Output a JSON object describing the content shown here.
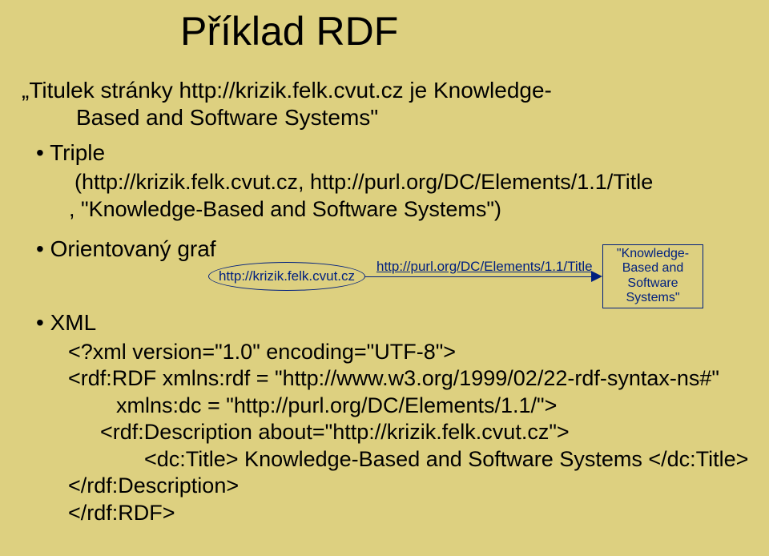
{
  "title": "Příklad RDF",
  "statement": {
    "line1": "„Titulek stránky http://krizik.felk.cvut.cz je Knowledge-",
    "line2": "Based and Software Systems\""
  },
  "bullets": {
    "triple": "Triple",
    "triple_sub1": "(http://krizik.felk.cvut.cz, http://purl.org/DC/Elements/1.1/Title",
    "triple_sub2": ", \"Knowledge-Based and Software Systems\")",
    "graf": "Orientovaný graf",
    "xml": "XML"
  },
  "graph": {
    "subject": "http://krizik.felk.cvut.cz",
    "predicate": "http://purl.org/DC/Elements/1.1/Title",
    "object": "\"Knowledge-Based and Software Systems\""
  },
  "xml": {
    "l1": "<?xml version=\"1.0\" encoding=\"UTF-8\">",
    "l2": "<rdf:RDF xmlns:rdf = \"http://www.w3.org/1999/02/22-rdf-syntax-ns#\"",
    "l3": "xmlns:dc = \"http://purl.org/DC/Elements/1.1/\">",
    "l4": "<rdf:Description about=\"http://krizik.felk.cvut.cz\">",
    "l5": "<dc:Title> Knowledge-Based and Software Systems </dc:Title>",
    "l6": "</rdf:Description>",
    "l7": "</rdf:RDF>"
  }
}
